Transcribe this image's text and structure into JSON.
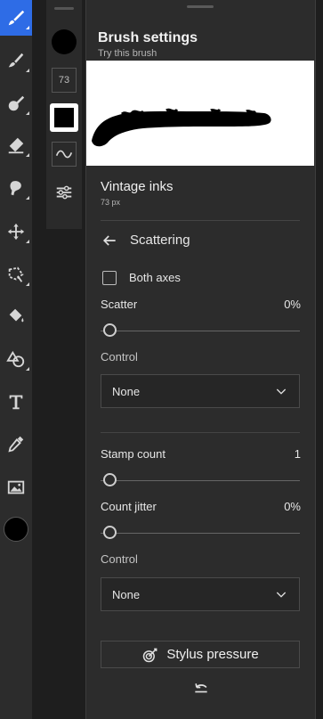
{
  "toolbar": {
    "tools": [
      {
        "name": "brush-icon",
        "active": true
      },
      {
        "name": "paint-brush-icon"
      },
      {
        "name": "mixer-brush-icon"
      },
      {
        "name": "eraser-icon"
      },
      {
        "name": "smudge-icon"
      },
      {
        "name": "move-icon"
      },
      {
        "name": "lasso-icon"
      },
      {
        "name": "paint-bucket-icon"
      },
      {
        "name": "shape-icon"
      },
      {
        "name": "type-icon"
      },
      {
        "name": "eyedropper-icon"
      },
      {
        "name": "image-icon"
      }
    ],
    "color_swatch": "#000000"
  },
  "subbar": {
    "brush_size": "73",
    "brush_color": "#000000"
  },
  "panel": {
    "title": "Brush settings",
    "subtitle": "Try this brush",
    "brush_name": "Vintage inks",
    "brush_size_label": "73 px",
    "section_title": "Scattering",
    "both_axes_label": "Both axes",
    "both_axes_checked": false,
    "scatter": {
      "label": "Scatter",
      "value": "0%",
      "level": 0
    },
    "control_label_1": "Control",
    "control_value_1": "None",
    "stamp_count": {
      "label": "Stamp count",
      "value": "1",
      "level": 0
    },
    "count_jitter": {
      "label": "Count jitter",
      "value": "0%",
      "level": 0
    },
    "control_label_2": "Control",
    "control_value_2": "None",
    "stylus_button": "Stylus pressure"
  },
  "colors": {
    "accent": "#2e6ce6",
    "panel_bg": "#2c2c2c",
    "app_bg": "#1e1e1e"
  }
}
